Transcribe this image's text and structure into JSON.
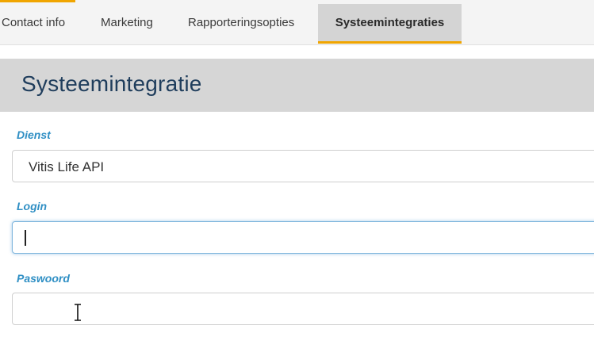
{
  "tabs": [
    {
      "label": "Contact info",
      "active": false
    },
    {
      "label": "Marketing",
      "active": false
    },
    {
      "label": "Rapporteringsopties",
      "active": false
    },
    {
      "label": "Systeemintegraties",
      "active": true
    }
  ],
  "section": {
    "title": "Systeemintegratie"
  },
  "form": {
    "dienst": {
      "label": "Dienst",
      "value": "Vitis Life API"
    },
    "login": {
      "label": "Login",
      "value": ""
    },
    "paswoord": {
      "label": "Paswoord",
      "value": ""
    }
  },
  "colors": {
    "accent": "#f0a500",
    "label": "#2f8fc4",
    "title": "#1f3d5c",
    "header_bg": "#d6d6d6"
  },
  "icons": {
    "cursor": "text-cursor-icon"
  }
}
